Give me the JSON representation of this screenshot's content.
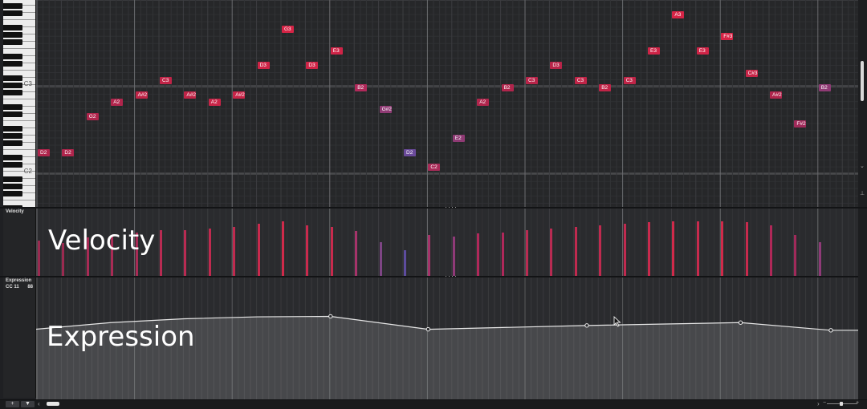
{
  "keyboard": {
    "labels": [
      {
        "text": "C3",
        "row": 11
      },
      {
        "text": "C2",
        "row": 23
      }
    ]
  },
  "notes": [
    {
      "label": "D2",
      "step": 0,
      "row": 21,
      "color": "#b0254c"
    },
    {
      "label": "D2",
      "step": 1,
      "row": 21,
      "color": "#b0254c"
    },
    {
      "label": "G2",
      "step": 2,
      "row": 16,
      "color": "#b0254c"
    },
    {
      "label": "A2",
      "step": 3,
      "row": 14,
      "color": "#b0254c"
    },
    {
      "label": "A#2",
      "step": 4,
      "row": 13,
      "color": "#c02447"
    },
    {
      "label": "C3",
      "step": 5,
      "row": 11,
      "color": "#c02447"
    },
    {
      "label": "A#2",
      "step": 6,
      "row": 13,
      "color": "#c02447"
    },
    {
      "label": "A2",
      "step": 7,
      "row": 14,
      "color": "#c82548"
    },
    {
      "label": "A#2",
      "step": 8,
      "row": 13,
      "color": "#c82548"
    },
    {
      "label": "D3",
      "step": 9,
      "row": 9,
      "color": "#cf2447"
    },
    {
      "label": "G3",
      "step": 10,
      "row": 4,
      "color": "#d52446"
    },
    {
      "label": "D3",
      "step": 11,
      "row": 9,
      "color": "#cf2447"
    },
    {
      "label": "E3",
      "step": 12,
      "row": 7,
      "color": "#cf2447"
    },
    {
      "label": "B2",
      "step": 13,
      "row": 12,
      "color": "#b0295a"
    },
    {
      "label": "G#2",
      "step": 14,
      "row": 15,
      "color": "#8f3a74"
    },
    {
      "label": "D2",
      "step": 15,
      "row": 21,
      "color": "#6a4a9a"
    },
    {
      "label": "C2",
      "step": 16,
      "row": 23,
      "color": "#a82b58"
    },
    {
      "label": "E2",
      "step": 17,
      "row": 19,
      "color": "#8f3a74"
    },
    {
      "label": "A2",
      "step": 18,
      "row": 14,
      "color": "#b0254c"
    },
    {
      "label": "B2",
      "step": 19,
      "row": 12,
      "color": "#b0254c"
    },
    {
      "label": "C3",
      "step": 20,
      "row": 11,
      "color": "#b82449"
    },
    {
      "label": "D3",
      "step": 21,
      "row": 9,
      "color": "#b82449"
    },
    {
      "label": "C3",
      "step": 22,
      "row": 11,
      "color": "#c02447"
    },
    {
      "label": "B2",
      "step": 23,
      "row": 12,
      "color": "#c02447"
    },
    {
      "label": "C3",
      "step": 24,
      "row": 11,
      "color": "#c02447"
    },
    {
      "label": "E3",
      "step": 25,
      "row": 7,
      "color": "#cf2447"
    },
    {
      "label": "A3",
      "step": 26,
      "row": 2,
      "color": "#d52446"
    },
    {
      "label": "E3",
      "step": 27,
      "row": 7,
      "color": "#cf2447"
    },
    {
      "label": "F#3",
      "step": 28,
      "row": 5,
      "color": "#d52446"
    },
    {
      "label": "C#3",
      "step": 29,
      "row": 10,
      "color": "#c82548"
    },
    {
      "label": "A#2",
      "step": 30,
      "row": 13,
      "color": "#b0254c"
    },
    {
      "label": "F#2",
      "step": 31,
      "row": 17,
      "color": "#a02a5a"
    },
    {
      "label": "B2",
      "step": 32,
      "row": 12,
      "color": "#8f3a74"
    }
  ],
  "velocity": {
    "name": "Velocity",
    "overlay": "Velocity",
    "max": 127,
    "values": [
      67,
      63,
      73,
      77,
      82,
      87,
      87,
      90,
      92,
      98,
      103,
      95,
      92,
      85,
      65,
      50,
      78,
      75,
      80,
      82,
      87,
      90,
      92,
      95,
      98,
      102,
      103,
      103,
      103,
      102,
      95,
      78,
      65
    ],
    "colors": [
      "#9a2a50",
      "#9a2a50",
      "#a82b55",
      "#a82b55",
      "#a82b55",
      "#b82b52",
      "#b82b52",
      "#c02a4f",
      "#c02a4f",
      "#c82a4d",
      "#d02a4a",
      "#c82a4d",
      "#c82a4d",
      "#a5336a",
      "#7e4585",
      "#5d4c9e",
      "#a5336a",
      "#8f3a78",
      "#b0285a",
      "#b0285a",
      "#b82b52",
      "#b82b52",
      "#c02a4f",
      "#c02a4f",
      "#c02a4f",
      "#c82a4d",
      "#d02a4a",
      "#c82a4d",
      "#d02a4a",
      "#c82a4d",
      "#b02858",
      "#a02a5a",
      "#8f3a78"
    ]
  },
  "expression": {
    "name": "Expression",
    "cc": "CC 11",
    "value": "88",
    "overlay": "Expression",
    "max": 127,
    "points": [
      {
        "step": -1.0,
        "value": 71
      },
      {
        "step": 3.0,
        "value": 80
      },
      {
        "step": 6.0,
        "value": 84
      },
      {
        "step": 9.0,
        "value": 86
      },
      {
        "step": 12.0,
        "value": 86.5
      },
      {
        "step": 16.0,
        "value": 73
      },
      {
        "step": 22.5,
        "value": 77
      },
      {
        "step": 28.8,
        "value": 80
      },
      {
        "step": 32.5,
        "value": 72
      },
      {
        "step": 34.0,
        "value": 72
      }
    ],
    "handles": [
      12.0,
      16.0,
      22.5,
      28.8,
      32.5
    ]
  },
  "bottom": {
    "add_label": "+",
    "down_label": "▼",
    "scroll_left": "‹",
    "scroll_right": "›",
    "zoom_out": "−",
    "zoom_in": "+"
  },
  "colors": {
    "grid_bg": "#262729",
    "lane_bg": "#2a2b2e",
    "fill": "#47484b",
    "curve": "#e6e6e6"
  }
}
